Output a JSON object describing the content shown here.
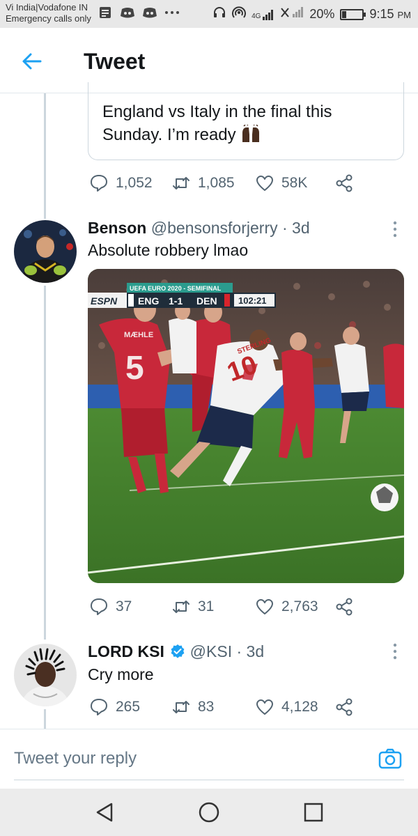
{
  "status_bar": {
    "carrier_line1": "Vi India|Vodafone IN",
    "carrier_line2": "Emergency calls only",
    "network": "4G",
    "battery_percent_label": "20%",
    "battery_level": 0.2,
    "time": "9:15",
    "time_suffix": "PM",
    "icons": [
      "message-icon",
      "discord-icon",
      "discord-icon",
      "more-dots-icon",
      "headset-icon",
      "hotspot-icon",
      "signal-icon",
      "no-signal-icon",
      "battery-icon"
    ]
  },
  "header": {
    "title": "Tweet",
    "back_icon": "back-arrow-icon"
  },
  "quoted_tweet": {
    "text": "England vs Italy in the final this Sunday. I’m ready",
    "emoji": "🙌🏿",
    "replies": "1,052",
    "retweets": "1,085",
    "likes": "58K"
  },
  "tweets": [
    {
      "name": "Benson",
      "handle": "@bensonsforjerry",
      "time": "· 3d",
      "text": "Absolute robbery lmao",
      "verified": false,
      "media": {
        "scorebug_title": "UEFA EURO 2020 - SEMIFINAL",
        "broadcaster": "ESPN",
        "team_home": "ENG",
        "score": "1-1",
        "team_away": "DEN",
        "clock": "102:21",
        "player_name_home": "MÆHLE",
        "player_number_home": "5",
        "player_name_away": "STERLING",
        "player_number_away": "10"
      },
      "replies": "37",
      "retweets": "31",
      "likes": "2,763"
    },
    {
      "name": "LORD KSI",
      "handle": "@KSI",
      "time": "· 3d",
      "text": "Cry more",
      "verified": true,
      "replies": "265",
      "retweets": "83",
      "likes": "4,128"
    }
  ],
  "reply_bar": {
    "placeholder": "Tweet your reply",
    "camera_icon": "camera-icon"
  },
  "colors": {
    "accent": "#1da1f2",
    "text_primary": "#14171a",
    "text_secondary": "#536471",
    "divider": "#e1e8ed"
  }
}
